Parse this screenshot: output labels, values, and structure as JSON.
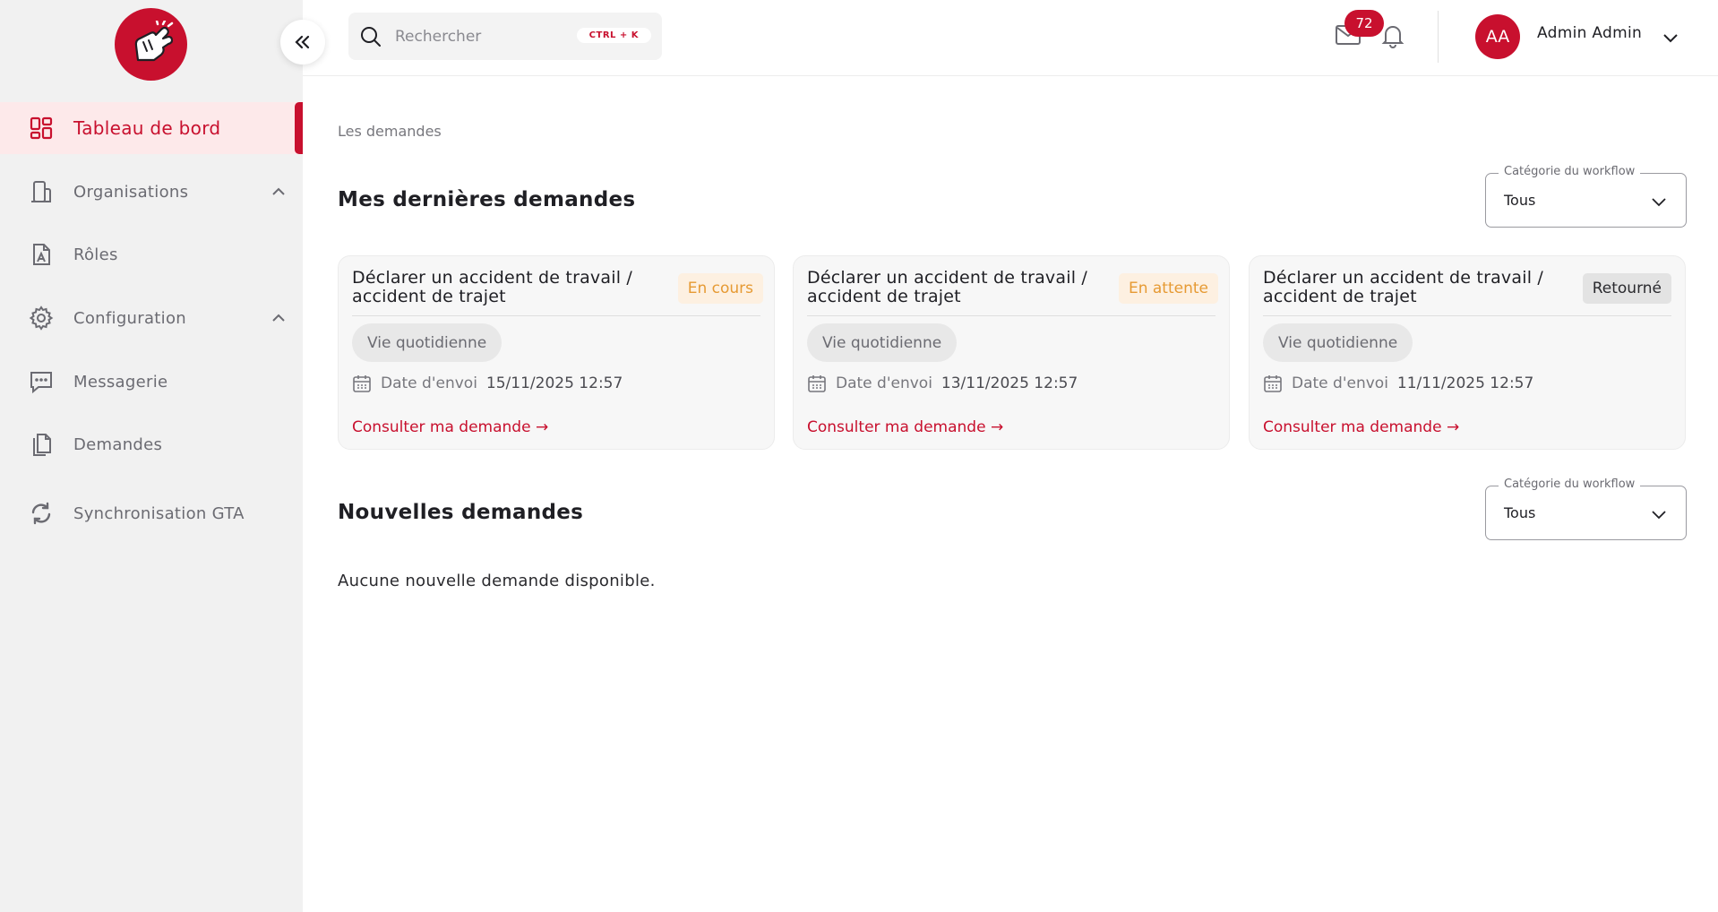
{
  "colors": {
    "brand": "#c8102e",
    "sidebar_bg": "#f1f1f1",
    "active_bg": "#fde9ea",
    "badge_orange": "#e69a33"
  },
  "sidebar": {
    "items": [
      {
        "label": "Tableau de bord",
        "icon": "grid-icon",
        "active": true
      },
      {
        "label": "Organisations",
        "icon": "building-icon",
        "expandable": true
      },
      {
        "label": "Rôles",
        "icon": "role-document-icon"
      },
      {
        "label": "Configuration",
        "icon": "gear-icon",
        "expandable": true
      },
      {
        "label": "Messagerie",
        "icon": "chat-icon"
      },
      {
        "label": "Demandes",
        "icon": "documents-icon"
      },
      {
        "label": "Synchronisation GTA",
        "icon": "sync-icon"
      }
    ]
  },
  "header": {
    "search_placeholder": "Rechercher",
    "search_shortcut": "CTRL + K",
    "mail_count": "72",
    "user_initials": "AA",
    "user_name": "Admin Admin"
  },
  "main": {
    "breadcrumb": "Les demandes",
    "recent": {
      "title": "Mes dernières demandes",
      "filter": {
        "label": "Catégorie du workflow",
        "value": "Tous"
      },
      "cards": [
        {
          "title": "Déclarer un accident de travail / accident de trajet",
          "status": "En cours",
          "category": "Vie quotidienne",
          "date_label": "Date d'envoi",
          "date_value": "15/11/2025 12:57",
          "link": "Consulter ma demande →"
        },
        {
          "title": "Déclarer un accident de travail / accident de trajet",
          "status": "En attente",
          "category": "Vie quotidienne",
          "date_label": "Date d'envoi",
          "date_value": "13/11/2025 12:57",
          "link": "Consulter ma demande →"
        },
        {
          "title": "Déclarer un accident de travail / accident de trajet",
          "status": "Retourné",
          "category": "Vie quotidienne",
          "date_label": "Date d'envoi",
          "date_value": "11/11/2025 12:57",
          "link": "Consulter ma demande →"
        }
      ]
    },
    "new": {
      "title": "Nouvelles demandes",
      "filter": {
        "label": "Catégorie du workflow",
        "value": "Tous"
      },
      "empty_text": "Aucune nouvelle demande disponible."
    }
  }
}
